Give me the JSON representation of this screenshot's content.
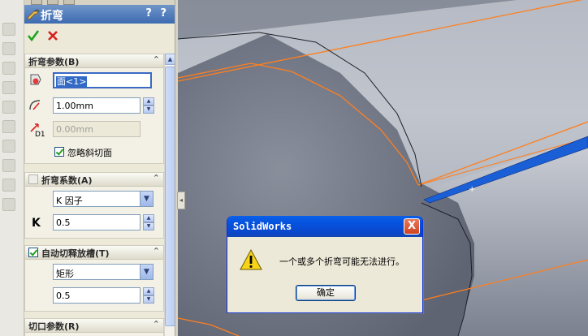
{
  "panel": {
    "title": "折弯",
    "help": "? ?",
    "ok_label": "",
    "cancel_label": "",
    "collapse_glyph": "⌃"
  },
  "groups": {
    "bend_params": {
      "title": "折弯参数(B)",
      "face_value": "面<1>",
      "radius_value": "1.00mm",
      "depth_value": "0.00mm",
      "depth_label": "D1",
      "ignore_bevel_label": "忽略斜切面"
    },
    "bend_allowance": {
      "title": "折弯系数(A)",
      "type_value": "K 因子",
      "k_label": "K",
      "k_value": "0.5"
    },
    "auto_relief": {
      "title": "自动切释放槽(T)",
      "type_value": "矩形",
      "ratio_value": "0.5"
    },
    "rip_params": {
      "title": "切口参数(R)"
    }
  },
  "dialog": {
    "title": "SolidWorks",
    "close_label": "X",
    "message": "一个或多个折弯可能无法进行。",
    "ok_label": "确定"
  },
  "colors": {
    "edge_highlight": "#ff7f1e",
    "selected_face": "#1a5fd6",
    "title_bar": "#0a4fd8"
  }
}
